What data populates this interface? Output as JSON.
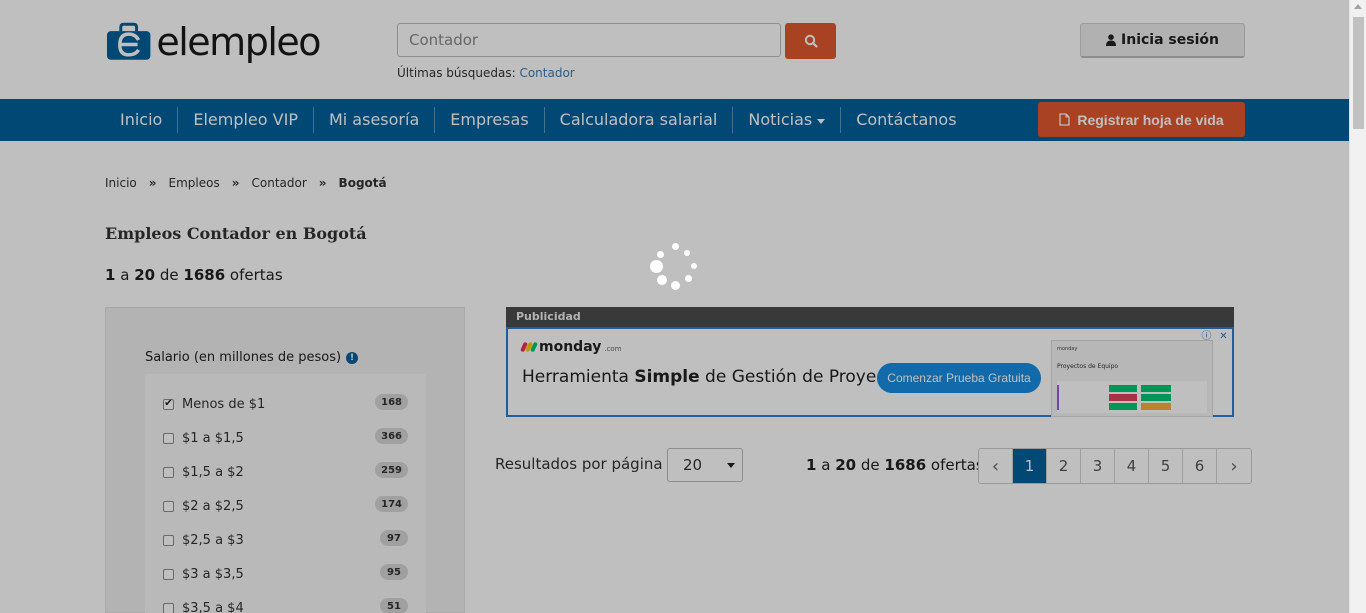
{
  "header": {
    "logo_text": "elempleo",
    "search": {
      "value": "",
      "placeholder": "Contador"
    },
    "recent_label": "Últimas búsquedas:",
    "recent_link": "Contador",
    "login_label": "Inicia sesión"
  },
  "nav": {
    "items": [
      {
        "label": "Inicio"
      },
      {
        "label": "Elempleo VIP"
      },
      {
        "label": "Mi asesoría"
      },
      {
        "label": "Empresas"
      },
      {
        "label": "Calculadora salarial"
      },
      {
        "label": "Noticias"
      },
      {
        "label": "Contáctanos"
      }
    ],
    "register_label": "Registrar hoja de vida"
  },
  "breadcrumb": {
    "items": [
      "Inicio",
      "Empleos",
      "Contador",
      "Bogotá"
    ],
    "separator": "»"
  },
  "main": {
    "title": "Empleos Contador en Bogotá",
    "range_start": "1",
    "range_connector": "a",
    "range_end": "20",
    "of_label": "de",
    "total": "1686",
    "offers_label": "ofertas"
  },
  "filter": {
    "title": "Salario (en millones de pesos)",
    "options": [
      {
        "label": "Menos de $1",
        "count": "168",
        "checked": true
      },
      {
        "label": "$1 a $1,5",
        "count": "366",
        "checked": false
      },
      {
        "label": "$1,5 a $2",
        "count": "259",
        "checked": false
      },
      {
        "label": "$2 a $2,5",
        "count": "174",
        "checked": false
      },
      {
        "label": "$2,5 a $3",
        "count": "97",
        "checked": false
      },
      {
        "label": "$3 a $3,5",
        "count": "95",
        "checked": false
      },
      {
        "label": "$3,5 a $4",
        "count": "51",
        "checked": false
      }
    ]
  },
  "ad": {
    "header": "Publicidad",
    "brand": "monday",
    "brand_suffix": ".com",
    "headline_pre": "Herramienta ",
    "headline_bold": "Simple",
    "headline_post": " de Gestión de Proyectos",
    "cta": "Comenzar Prueba Gratuita",
    "preview_brand": "monday",
    "preview_title": "Proyectos de Equipo"
  },
  "pagination": {
    "per_page_label": "Resultados por página",
    "per_page_value": "20",
    "pages": [
      "1",
      "2",
      "3",
      "4",
      "5",
      "6"
    ],
    "active_page": "1",
    "prev": "‹",
    "next": "›"
  },
  "colors": {
    "primary_blue": "#02609c",
    "accent_orange": "#e2582f",
    "overlay": "rgba(0,0,0,0.25)"
  }
}
